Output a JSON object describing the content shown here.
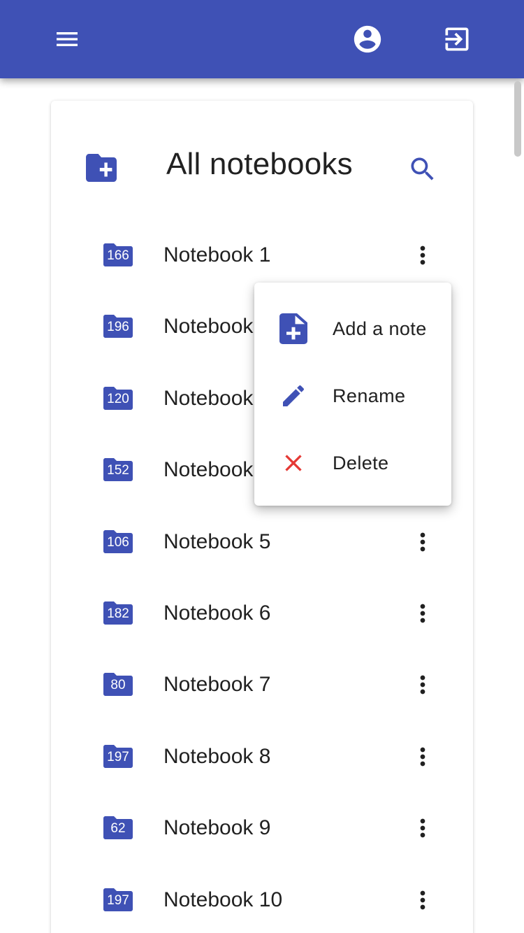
{
  "appbar": {
    "menu_icon": "hamburger-menu-icon",
    "account_icon": "account-circle-icon",
    "logout_icon": "exit-icon",
    "color": "#3f51b5"
  },
  "header": {
    "title": "All notebooks",
    "new_folder_icon": "create-new-folder-icon",
    "search_icon": "search-icon"
  },
  "notebooks": [
    {
      "count": "166",
      "name": "Notebook 1"
    },
    {
      "count": "196",
      "name": "Notebook"
    },
    {
      "count": "120",
      "name": "Notebook"
    },
    {
      "count": "152",
      "name": "Notebook"
    },
    {
      "count": "106",
      "name": "Notebook 5"
    },
    {
      "count": "182",
      "name": "Notebook 6"
    },
    {
      "count": "80",
      "name": "Notebook 7"
    },
    {
      "count": "197",
      "name": "Notebook 8"
    },
    {
      "count": "62",
      "name": "Notebook 9"
    },
    {
      "count": "197",
      "name": "Notebook 10"
    }
  ],
  "context_menu": {
    "items": [
      {
        "label": "Add a note",
        "icon": "note-add-icon"
      },
      {
        "label": "Rename",
        "icon": "pencil-icon"
      },
      {
        "label": "Delete",
        "icon": "close-icon"
      }
    ],
    "delete_color": "#e53935"
  },
  "colors": {
    "accent": "#3f51b5",
    "text": "#212121"
  }
}
